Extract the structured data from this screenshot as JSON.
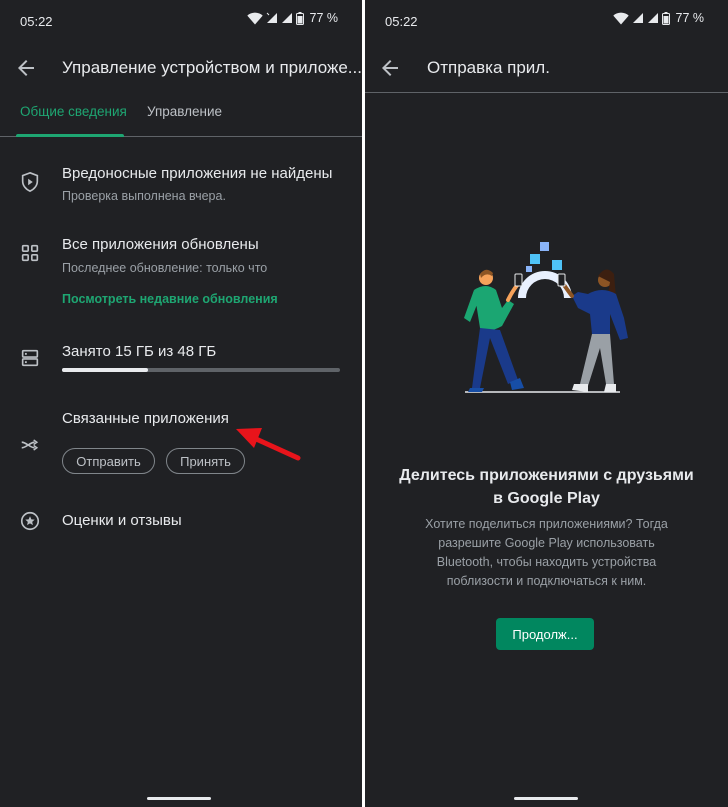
{
  "status_bar": {
    "time": "05:22",
    "battery": "77 %"
  },
  "left_screen": {
    "title": "Управление устройством и приложе...",
    "tabs": [
      {
        "label": "Общие сведения",
        "active": true
      },
      {
        "label": "Управление",
        "active": false
      }
    ],
    "protect": {
      "icon": "shield-play-icon",
      "title": "Вредоносные приложения не найдены",
      "subtitle": "Проверка выполнена вчера."
    },
    "updates": {
      "icon": "apps-grid-icon",
      "title": "Все приложения обновлены",
      "subtitle": "Последнее обновление: только что",
      "link": "Посмотреть недавние обновления"
    },
    "storage": {
      "icon": "storage-icon",
      "title": "Занято 15 ГБ из 48 ГБ",
      "used_fraction": 0.31
    },
    "share": {
      "icon": "share-apps-icon",
      "title": "Связанные приложения",
      "send_label": "Отправить",
      "receive_label": "Принять"
    },
    "ratings": {
      "icon": "star-circle-icon",
      "title": "Оценки и отзывы"
    }
  },
  "right_screen": {
    "title": "Отправка прил.",
    "heading_line1": "Делитесь приложениями с друзьями",
    "heading_line2": "в Google Play",
    "body_lines": [
      "Хотите поделиться приложениями? Тогда",
      "разрешите Google Play использовать",
      "Bluetooth, чтобы находить устройства",
      "поблизости и подключаться к ним."
    ],
    "continue_label": "Продолж..."
  },
  "colors": {
    "background": "#202124",
    "accent": "#1ea672",
    "button": "#01875f",
    "annotation_arrow": "#e8141b"
  }
}
